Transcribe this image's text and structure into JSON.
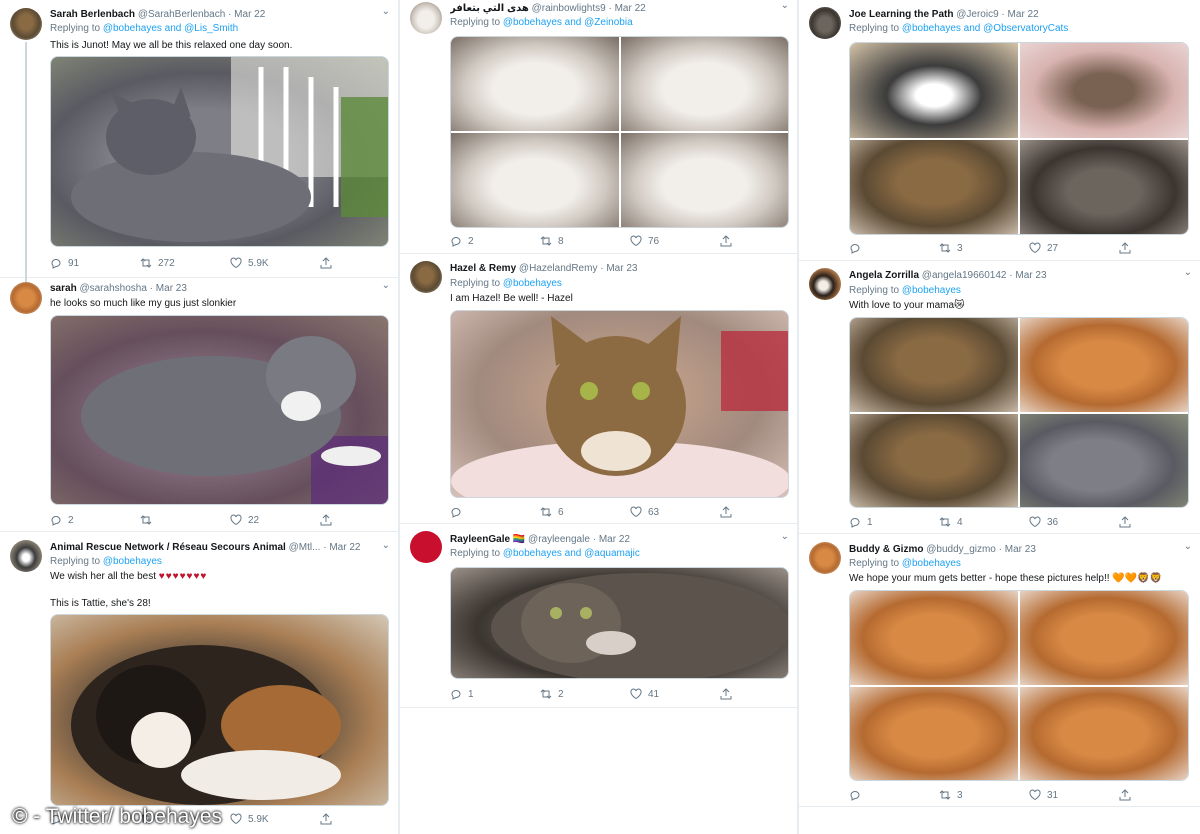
{
  "tweets": {
    "t1": {
      "name": "Sarah Berlenbach",
      "handle": "@SarahBerlenbach",
      "date": "Mar 22",
      "replying": "Replying to",
      "mentions": "@bobehayes and @Lis_Smith",
      "text": "This is Junot! May we all be this relaxed one day soon.",
      "replies": "91",
      "retweets": "272",
      "likes": "5.9K",
      "image": "grey cat relaxing on porch"
    },
    "t2": {
      "name": "sarah",
      "handle": "@sarahshosha",
      "date": "Mar 23",
      "text": "he looks so much like my gus just slonkier",
      "replies": "2",
      "retweets": "",
      "likes": "22",
      "image": "grey and white cat on quilt"
    },
    "t3": {
      "name": "Animal Rescue Network / Réseau Secours Animal",
      "handle": "@Mtl...",
      "date": "Mar 22",
      "replying": "Replying to",
      "mentions": "@bobehayes",
      "text": "We wish her all the best",
      "hearts": "♥♥♥♥♥♥♥",
      "text2": "This is Tattie, she's 28!",
      "likes": "5.9K",
      "image": "calico cat in box"
    },
    "t4": {
      "name": "هدى التي بتعافر",
      "handle": "@rainbowlights9",
      "date": "Mar 22",
      "replying": "Replying to",
      "mentions": "@bobehayes and @Zeinobia",
      "replies": "2",
      "retweets": "8",
      "likes": "76",
      "images": [
        "fluffy kitten",
        "fluffy kitten",
        "fluffy kitten with clip",
        "fluffy kitten"
      ]
    },
    "t5": {
      "name": "Hazel & Remy",
      "handle": "@HazelandRemy",
      "date": "Mar 23",
      "replying": "Replying to",
      "mentions": "@bobehayes",
      "text": "I am Hazel! Be well! - Hazel",
      "replies": "",
      "retweets": "6",
      "likes": "63",
      "image": "tabby cat in pink bed"
    },
    "t6": {
      "name": "RayleenGale 🏳️‍🌈",
      "handle": "@rayleengale",
      "date": "Mar 22",
      "replying": "Replying to",
      "mentions": "@bobehayes and @aquamajic",
      "replies": "1",
      "retweets": "2",
      "likes": "41",
      "image": "long-haired tabby lying down"
    },
    "t7": {
      "name": "Joe Learning the Path",
      "handle": "@Jeroic9",
      "date": "Mar 22",
      "replying": "Replying to",
      "mentions": "@bobehayes and @ObservatoryCats",
      "replies": "",
      "retweets": "3",
      "likes": "27",
      "images": [
        "tabby and white cat",
        "dark cat on rug",
        "cat face close-up",
        "tabby cat on bed"
      ]
    },
    "t8": {
      "name": "Angela Zorrilla",
      "handle": "@angela19660142",
      "date": "Mar 23",
      "replying": "Replying to",
      "mentions": "@bobehayes",
      "text": "With love to your mama😿",
      "replies": "1",
      "retweets": "4",
      "likes": "36",
      "images": [
        "tabby kitten paws up",
        "orange kitten paw",
        "tabby kitten upside down",
        "grey kitten tongue out"
      ]
    },
    "t9": {
      "name": "Buddy & Gizmo",
      "handle": "@buddy_gizmo",
      "date": "Mar 23",
      "replying": "Replying to",
      "mentions": "@bobehayes",
      "text": "We hope your mum gets better - hope these pictures help!! 🧡🧡🦁🦁",
      "replies": "",
      "retweets": "3",
      "likes": "31",
      "images": [
        "maine coon cat",
        "two maine coon cats",
        "maine coon cat",
        "two maine coon kittens"
      ]
    }
  },
  "watermark": "© - Twitter/ bobehayes",
  "icons": {
    "reply": "reply-icon",
    "retweet": "retweet-icon",
    "like": "heart-icon",
    "share": "share-icon",
    "chevron": "chevron-down-icon"
  }
}
